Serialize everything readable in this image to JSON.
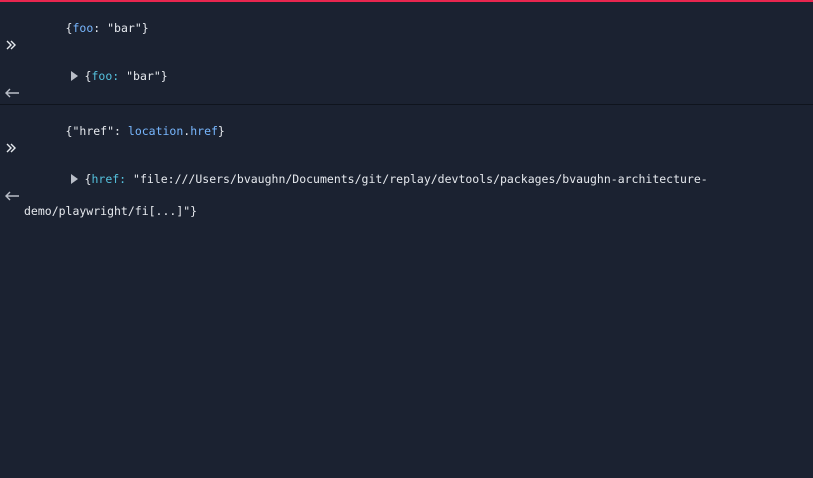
{
  "colors": {
    "background": "#1b2231",
    "accent_top_border": "#e8264f",
    "key": "#55c2de",
    "identifier": "#78b7ff",
    "text": "#e6e9ee"
  },
  "entries": [
    {
      "input_icon": "chevron-double-right-icon",
      "input": {
        "open": "{",
        "key": "foo",
        "colon": ": ",
        "value": "\"bar\"",
        "close": "}"
      },
      "output_icon": "arrow-left-icon",
      "output": {
        "open": "{",
        "key": "foo:",
        "space": " ",
        "value": "\"bar\"",
        "close": "}"
      }
    },
    {
      "input_icon": "chevron-double-right-icon",
      "input": {
        "open": "{",
        "key_string": "\"href\"",
        "colon": ": ",
        "object": "location",
        "dot": ".",
        "property": "href",
        "close": "}"
      },
      "output_icon": "arrow-left-icon",
      "output": {
        "open": "{",
        "key": "href:",
        "space": " ",
        "value_line1": "\"file:///Users/bvaughn/Documents/git/replay/devtools/packages/bvaughn-architecture-",
        "value_line2": "demo/playwright/fi[...]\"",
        "close": "}"
      }
    }
  ]
}
